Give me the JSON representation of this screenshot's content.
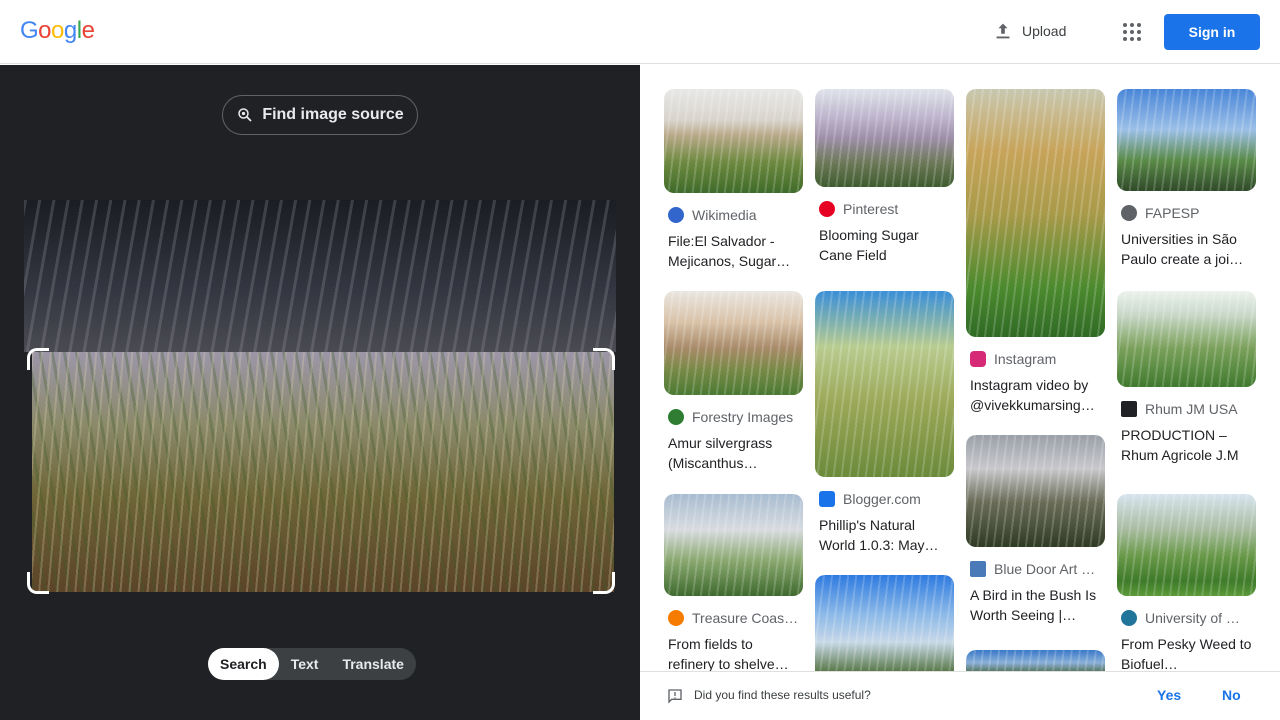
{
  "header": {
    "logo": "Google",
    "upload_label": "Upload",
    "apps_icon": "apps-grid-icon",
    "signin_label": "Sign in"
  },
  "left_panel": {
    "find_source_label": "Find image source",
    "modes": [
      "Search",
      "Text",
      "Translate"
    ],
    "active_mode": "Search"
  },
  "results": [
    {
      "source": "Wikimedia",
      "title": "File:El Salvador - Mejicanos, Sugar…",
      "favicon_color": "#3366cc"
    },
    {
      "source": "Pinterest",
      "title": "Blooming Sugar Cane Field",
      "favicon_color": "#e60023"
    },
    {
      "source": "Instagram",
      "title": "Instagram video by @vivekkumarsing…",
      "favicon_color": "#d62976"
    },
    {
      "source": "FAPESP",
      "title": "Universities in São Paulo create a joi…",
      "favicon_color": "#5f6368"
    },
    {
      "source": "Forestry Images",
      "title": "Amur silvergrass (Miscanthus…",
      "favicon_color": "#2e7d32"
    },
    {
      "source": "Blogger.com",
      "title": "Phillip's Natural World 1.0.3: May…",
      "favicon_color": "#1a73e8"
    },
    {
      "source": "Blue Door Art …",
      "title": "A Bird in the Bush Is Worth Seeing |…",
      "favicon_color": "#4a7ab8"
    },
    {
      "source": "Rhum JM USA",
      "title": "PRODUCTION – Rhum Agricole J.M",
      "favicon_color": "#202124"
    },
    {
      "source": "Treasure Coas…",
      "title": "From fields to refinery to shelve…",
      "favicon_color": "#f57c00"
    },
    {
      "source": "University of …",
      "title": "From Pesky Weed to Biofuel…",
      "favicon_color": "#21759b"
    }
  ],
  "footer": {
    "question": "Did you find these results useful?",
    "yes_label": "Yes",
    "no_label": "No"
  }
}
